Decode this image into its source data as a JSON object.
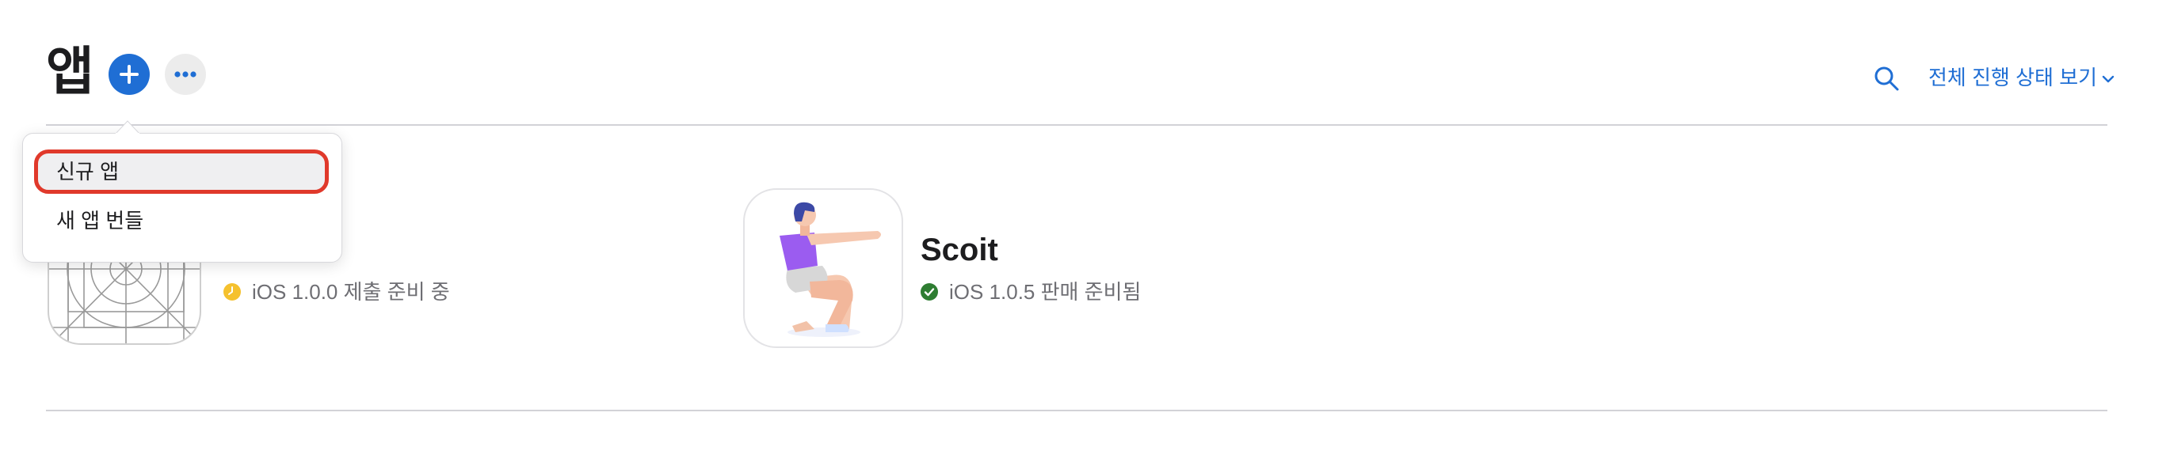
{
  "header": {
    "title": "앱",
    "view_status_label": "전체 진행 상태 보기"
  },
  "icons": {
    "add": "plus-circle-icon",
    "more": "ellipsis-icon",
    "search": "search-icon",
    "dropdown": "chevron-down-icon"
  },
  "add_menu": {
    "items": [
      {
        "label": "신규 앱",
        "highlighted": true
      },
      {
        "label": "새 앱 번들",
        "highlighted": false
      }
    ]
  },
  "apps": [
    {
      "name": "",
      "status": "iOS 1.0.0 제출 준비 중",
      "status_color": "#f5c12e",
      "status_icon": "clock-icon"
    },
    {
      "name": "Scoit",
      "status": "iOS 1.0.5 판매 준비됨",
      "status_color": "#2e7d32",
      "status_icon": "checkmark-icon"
    }
  ],
  "colors": {
    "accent": "#1f6ed4",
    "highlight_border": "#e0392b"
  }
}
